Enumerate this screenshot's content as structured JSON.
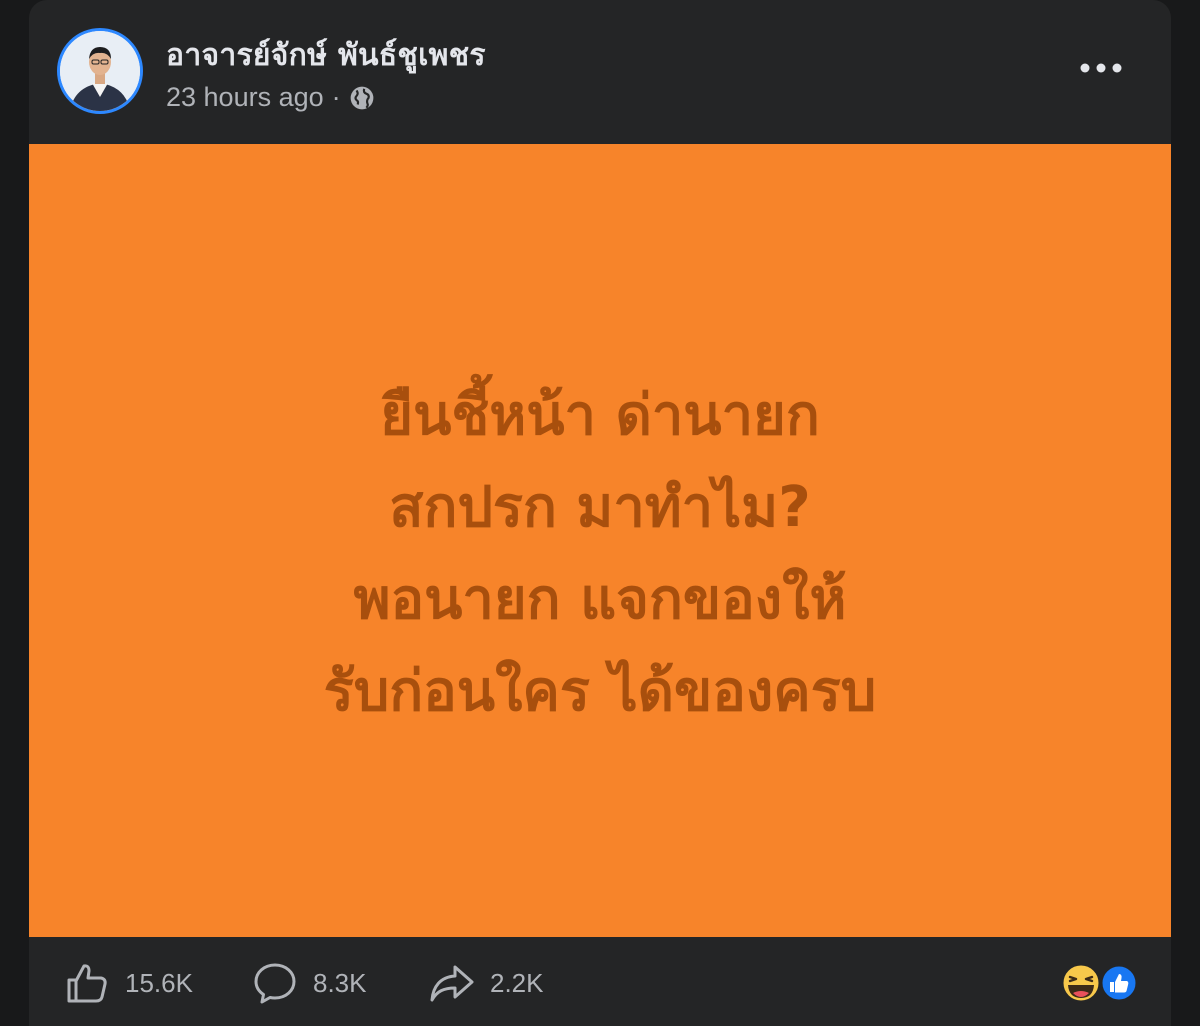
{
  "post": {
    "author": "อาจารย์จักษ์ พันธ์ชูเพชร",
    "timestamp": "23 hours ago",
    "separator": "·",
    "privacy_icon": "globe-icon",
    "more_icon": "more-options-icon",
    "image": {
      "background_color": "#f7842a",
      "text_color": "#a84f0d",
      "lines": [
        "ยืนชี้หน้า ด่านายก",
        "สกปรก มาทำไม?",
        "พอนายก แจกของให้",
        "รับก่อนใคร ได้ของครบ"
      ]
    }
  },
  "actions": {
    "like": {
      "icon": "like-icon",
      "count": "15.6K"
    },
    "comment": {
      "icon": "comment-icon",
      "count": "8.3K"
    },
    "share": {
      "icon": "share-icon",
      "count": "2.2K"
    }
  },
  "reactions": [
    "haha-icon",
    "like-reaction-icon"
  ]
}
